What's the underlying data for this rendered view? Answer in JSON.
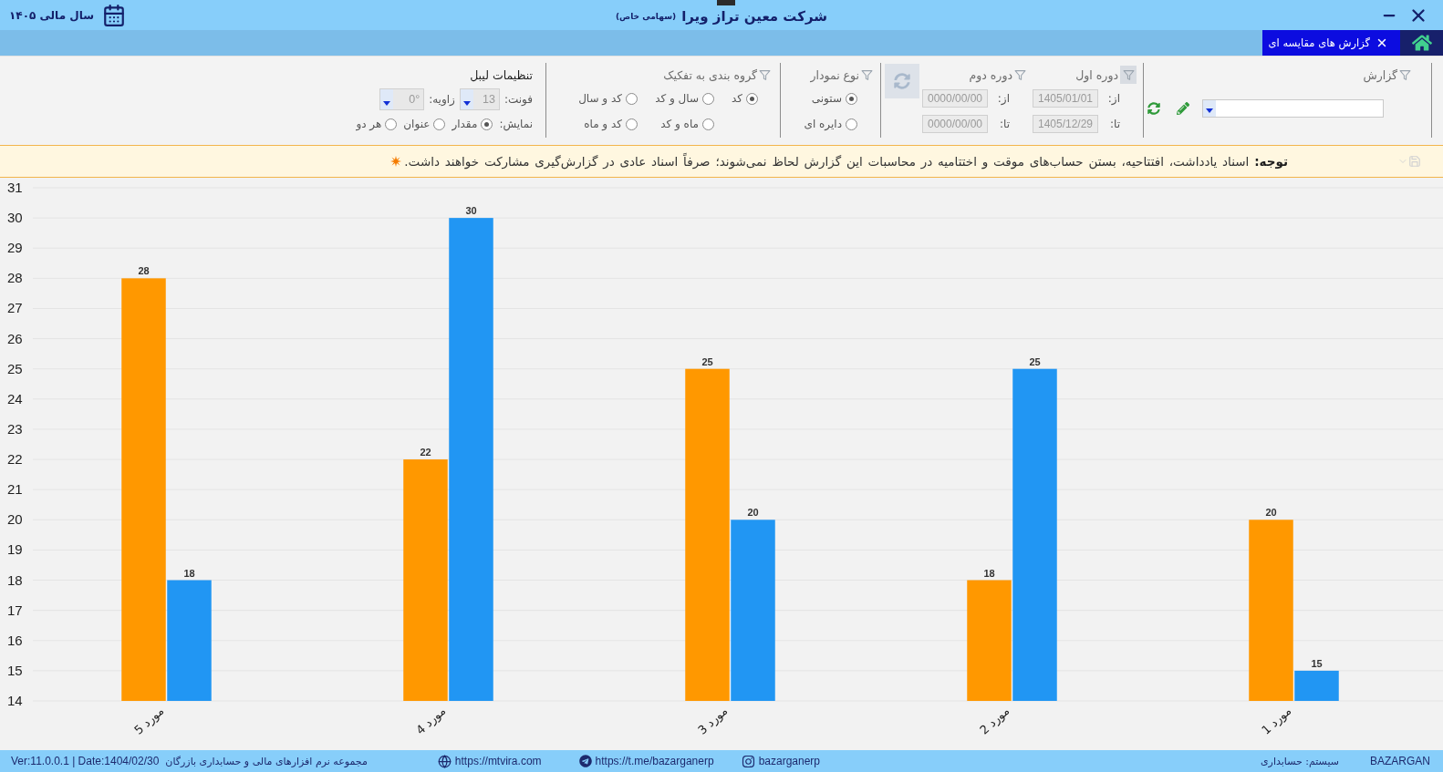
{
  "title_bar": {
    "fiscal_year": "سال مالی ۱۴۰۵",
    "company": "شرکت معین تراز ویرا",
    "company_type": "(سهامی خاص)"
  },
  "tabs": [
    {
      "label": "گزارش های مقایسه ای",
      "selected": true
    }
  ],
  "toolbar": {
    "report": {
      "title": "گزارش",
      "highlighted": false
    },
    "period_1": {
      "title": "دوره اول",
      "highlighted": true,
      "disabled": true,
      "from_label": "از:",
      "from": "1405/01/01",
      "to_label": "تا:",
      "to": "1405/12/29"
    },
    "period_2": {
      "title": "دوره دوم",
      "highlighted": false,
      "disabled": true,
      "from_label": "از:",
      "from": "0000/00/00",
      "to_label": "تا:",
      "to": "0000/00/00"
    },
    "period_refresh": {
      "disabled": true
    },
    "chart_type": {
      "title": "نوع نمودار",
      "highlighted": false,
      "options": [
        {
          "label": "ستونی",
          "selected": true
        },
        {
          "label": "دایره ای",
          "selected": false
        }
      ]
    },
    "grouping": {
      "title": "گروه بندی به تفکیک",
      "highlighted": false,
      "options": [
        {
          "label": "کد",
          "selected": true
        },
        {
          "label": "سال و کد",
          "selected": false
        },
        {
          "label": "کد و سال",
          "selected": false
        },
        {
          "label": "ماه و کد",
          "selected": false
        },
        {
          "label": "کد و ماه",
          "selected": false
        }
      ]
    },
    "label_settings": {
      "title": "تنظیمات لیبل",
      "font_label": "فونت:",
      "font_size": "13",
      "angle_label": "زاویه:",
      "angle": "0°",
      "spinners_disabled": true,
      "display_label": "نمایش:",
      "display_options": [
        {
          "label": "مقدار",
          "selected": true
        },
        {
          "label": "عنوان",
          "selected": false
        },
        {
          "label": "هر دو",
          "selected": false
        }
      ]
    }
  },
  "notice": {
    "text": "**توجه:**  اسناد یادداشت، افتتاحیه، بستن حساب‌های موقت و اختتامیه در محاسبات این گزارش لحاظ نمی‌شوند؛ صرفاً اسناد عادی در گزارش‌گیری مشارکت خواهند داشت."
  },
  "chart_data": {
    "type": "bar",
    "categories": [
      "مورد 5",
      "مورد 4",
      "مورد 3",
      "مورد 2",
      "مورد 1"
    ],
    "series": [
      {
        "color": "#ff9800",
        "values": [
          28,
          22,
          25,
          18,
          20
        ]
      },
      {
        "color": "#2196f3",
        "values": [
          18,
          30,
          20,
          25,
          15
        ]
      }
    ],
    "ylim": [
      14,
      31
    ],
    "yticks": [
      14,
      15,
      16,
      17,
      18,
      19,
      20,
      21,
      22,
      23,
      24,
      25,
      26,
      27,
      28,
      29,
      30,
      31
    ],
    "grid": true,
    "data_labels": true
  },
  "status_bar": {
    "version": "Ver:11.0.0.1 | Date:1404/02/30",
    "product": "مجموعه نرم افزارهای مالی و حسابداری بازرگان",
    "website": "https://mtvira.com",
    "telegram": "https://t.me/bazarganerp",
    "instagram": "bazarganerp",
    "system": "سیستم: حسابداری",
    "brand": "BAZARGAN"
  }
}
